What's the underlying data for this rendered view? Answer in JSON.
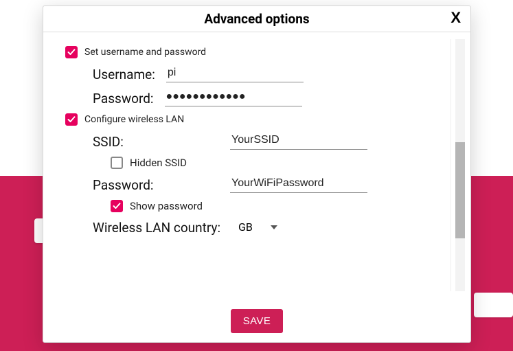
{
  "dialog": {
    "title": "Advanced options",
    "close_label": "X"
  },
  "set_user": {
    "checkbox_label": "Set username and password",
    "username_label": "Username:",
    "username_value": "pi",
    "password_label": "Password:",
    "password_value": "●●●●●●●●●●●●"
  },
  "wifi": {
    "checkbox_label": "Configure wireless LAN",
    "ssid_label": "SSID:",
    "ssid_value": "YourSSID",
    "hidden_ssid_label": "Hidden SSID",
    "password_label": "Password:",
    "password_value": "YourWiFiPassword",
    "show_password_label": "Show password",
    "country_label": "Wireless LAN country:",
    "country_value": "GB"
  },
  "footer": {
    "save_label": "SAVE"
  }
}
